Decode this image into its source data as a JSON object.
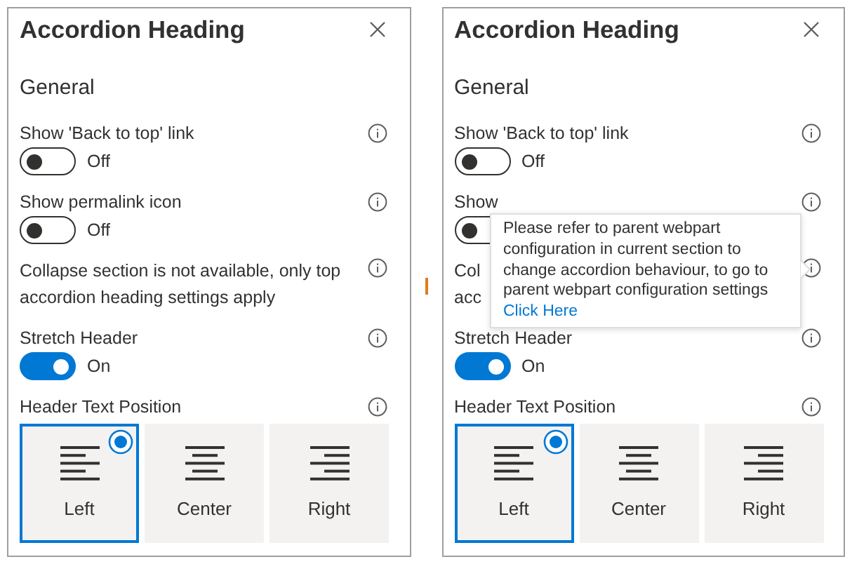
{
  "panels": [
    {
      "title": "Accordion Heading",
      "section": "General",
      "settings": [
        {
          "kind": "toggle",
          "label": "Show 'Back to top' link",
          "on": false,
          "state_text": "Off"
        },
        {
          "kind": "toggle",
          "label": "Show permalink icon",
          "on": false,
          "state_text": "Off"
        },
        {
          "kind": "note",
          "lines": [
            "Collapse section is not available, only top",
            "accordion heading settings apply"
          ]
        },
        {
          "kind": "toggle",
          "label": "Stretch Header",
          "on": true,
          "state_text": "On"
        }
      ],
      "position": {
        "label": "Header Text Position",
        "options": [
          {
            "label": "Left",
            "selected": true
          },
          {
            "label": "Center",
            "selected": false
          },
          {
            "label": "Right",
            "selected": false
          }
        ]
      }
    },
    {
      "title": "Accordion Heading",
      "section": "General",
      "settings": [
        {
          "kind": "toggle",
          "label": "Show 'Back to top' link",
          "on": false,
          "state_text": "Off"
        },
        {
          "kind": "toggle",
          "label": "Show",
          "on": false
        },
        {
          "kind": "note",
          "lines": [
            "Col",
            "acc"
          ]
        },
        {
          "kind": "toggle",
          "label": "Stretch Header",
          "on": true,
          "state_text": "On"
        }
      ],
      "position": {
        "label": "Header Text Position",
        "options": [
          {
            "label": "Left",
            "selected": true
          },
          {
            "label": "Center",
            "selected": false
          },
          {
            "label": "Right",
            "selected": false
          }
        ]
      },
      "tooltip": {
        "text": "Please refer to parent webpart configuration in current section to change accordion behaviour, to go to parent webpart configuration settings",
        "link": "Click Here"
      }
    }
  ]
}
